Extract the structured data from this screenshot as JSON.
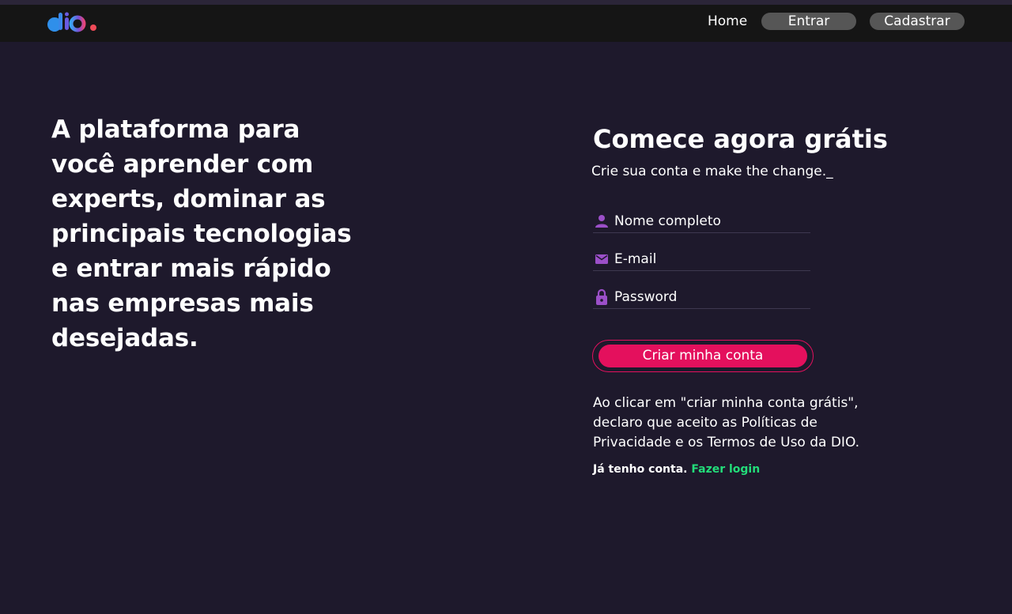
{
  "header": {
    "logo_text": "dio.",
    "nav": {
      "home_label": "Home",
      "login_label": "Entrar",
      "signup_label": "Cadastrar"
    }
  },
  "hero": {
    "title": "A plataforma para você aprender com experts, dominar as principais tecnologias e entrar mais rápido nas empresas mais desejadas."
  },
  "form": {
    "title": "Comece agora grátis",
    "subtitle": "Crie sua conta e make the change._",
    "fields": {
      "name_placeholder": "Nome completo",
      "email_placeholder": "E-mail",
      "password_placeholder": "Password"
    },
    "submit_label": "Criar minha conta",
    "terms_text": "Ao clicar em \"criar minha conta grátis\", declaro que aceito as Políticas de Privacidade e os Termos de Uso da DIO.",
    "have_account_text": "Já tenho conta.",
    "login_link_text": "Fazer login"
  },
  "colors": {
    "background": "#1e192c",
    "header": "#151515",
    "accent": "#e4105d",
    "link": "#23dd7a",
    "icon": "#9b4fc8",
    "nav_button": "#565656"
  },
  "icons": [
    "dio-logo",
    "user-icon",
    "mail-icon",
    "lock-icon"
  ]
}
